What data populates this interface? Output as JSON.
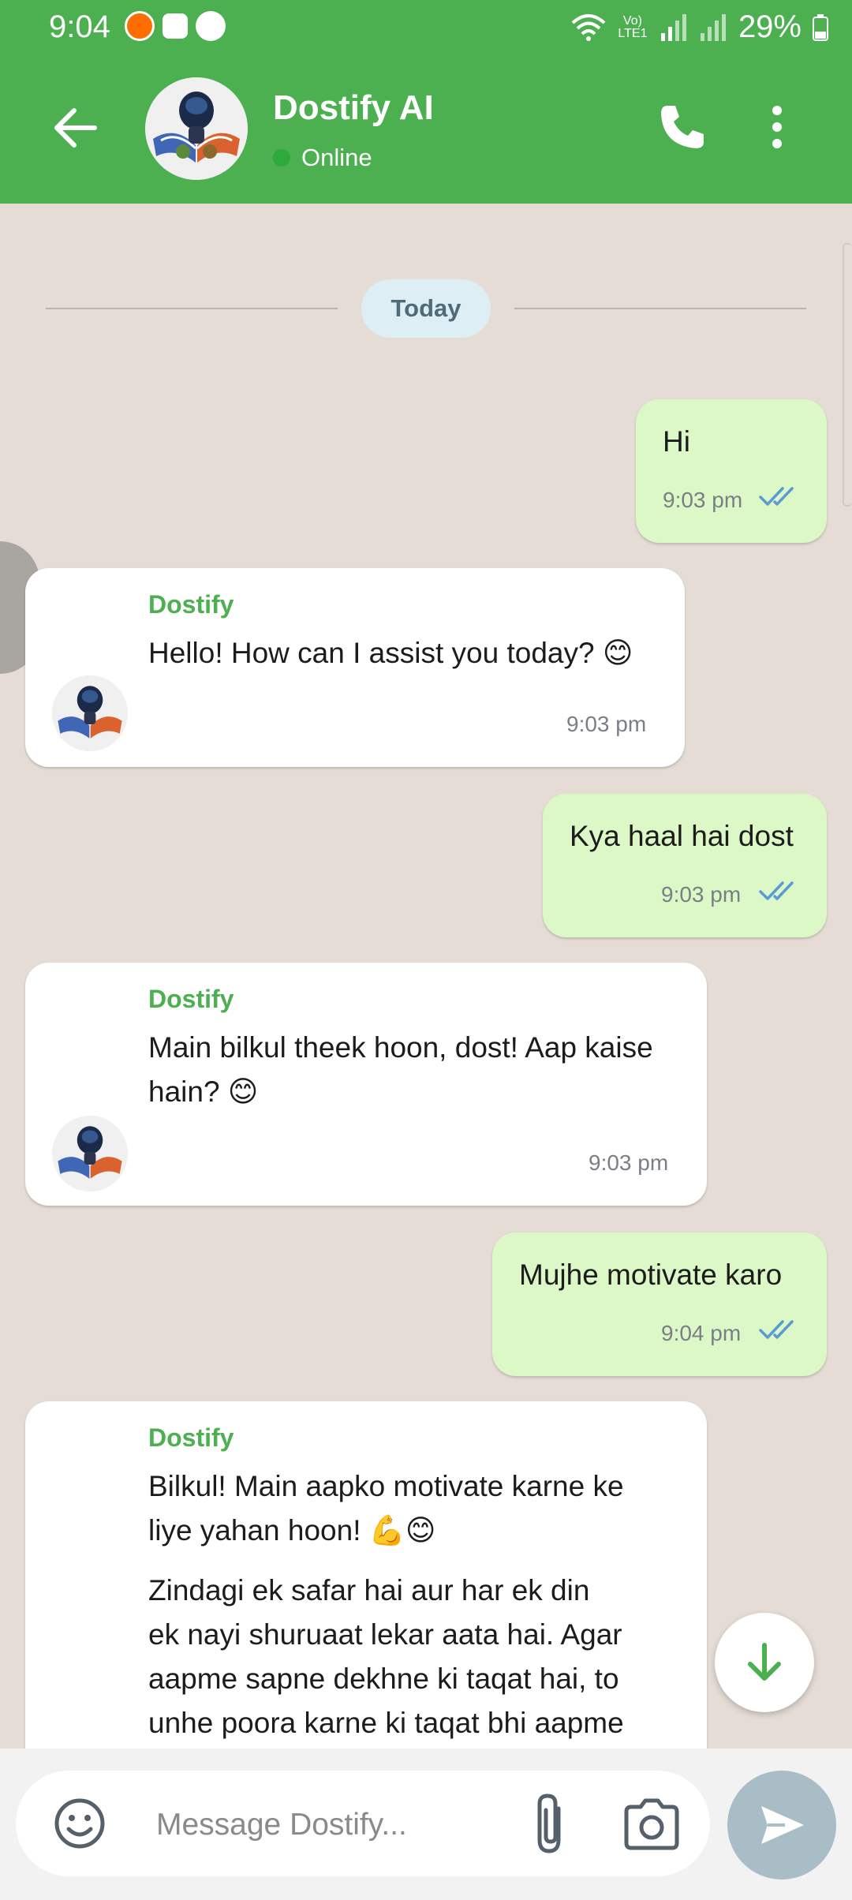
{
  "status_bar": {
    "time": "9:04",
    "network_label": "Vo) LTE1",
    "battery": "29%"
  },
  "header": {
    "title": "Dostify AI",
    "status": "Online",
    "icons": [
      "back-arrow-icon",
      "phone-icon",
      "more-vert-icon"
    ]
  },
  "chat": {
    "date_label": "Today",
    "messages": [
      {
        "direction": "out",
        "text": "Hi",
        "time": "9:03 pm"
      },
      {
        "direction": "in",
        "sender": "Dostify",
        "text": "Hello! How can I assist you today? 😊",
        "time": "9:03 pm"
      },
      {
        "direction": "out",
        "text": "Kya haal hai dost",
        "time": "9:03 pm"
      },
      {
        "direction": "in",
        "sender": "Dostify",
        "text_line1": "Main bilkul theek hoon, dost! Aap kaise",
        "text_line2": "hain? 😊",
        "time": "9:03 pm"
      },
      {
        "direction": "out",
        "text": "Mujhe motivate karo",
        "time": "9:04 pm"
      },
      {
        "direction": "in",
        "sender": "Dostify",
        "para1_line1": "Bilkul! Main aapko motivate karne ke",
        "para1_line2": "liye yahan hoon! 💪😊",
        "para2_line1": "Zindagi ek safar hai aur har ek din",
        "para2_line2": "ek nayi shuruaat lekar aata hai. Agar",
        "para2_line3": "aapme sapne dekhne ki taqat hai, to",
        "para2_line4": "unhe poora karne ki taqat bhi aapme"
      }
    ]
  },
  "composer": {
    "placeholder": "Message Dostify...",
    "icons": [
      "emoji-icon",
      "paperclip-icon",
      "camera-icon",
      "send-icon"
    ]
  },
  "colors": {
    "brand_green": "#4caf50",
    "outgoing_bubble": "#dcf8c6",
    "chat_background": "#e5ddd5",
    "read_ticks": "#5b9bd5"
  }
}
